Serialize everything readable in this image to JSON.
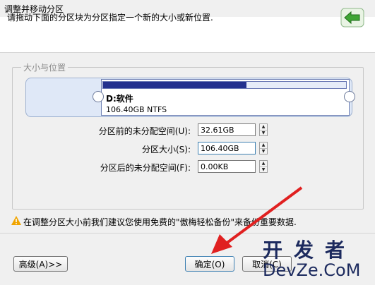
{
  "window": {
    "title": "调整并移动分区"
  },
  "header": {
    "instruction": "请拖动下面的分区块为分区指定一个新的大小或新位置."
  },
  "group": {
    "legend": "大小与位置"
  },
  "partition": {
    "name": "D:软件",
    "size_fs": "106.40GB NTFS",
    "used_fraction": 0.59
  },
  "fields": {
    "free_before": {
      "label": "分区前的未分配空间(U):",
      "value": "32.61GB"
    },
    "size": {
      "label": "分区大小(S):",
      "value": "106.40GB"
    },
    "free_after": {
      "label": "分区后的未分配空间(F):",
      "value": "0.00KB"
    }
  },
  "warning": {
    "text": "在调整分区大小前我们建议您使用免费的\"傲梅轻松备份\"来备份重要数据."
  },
  "buttons": {
    "advanced": "高级(A)>>",
    "ok": "确定(O)",
    "cancel": "取消(C)"
  },
  "watermark": {
    "cn": "开发者",
    "en": "DevZe.CoM"
  },
  "icons": {
    "back": "green-back-arrow-icon",
    "warning": "warning-triangle-icon",
    "spin": "up-down-arrow-icon"
  }
}
